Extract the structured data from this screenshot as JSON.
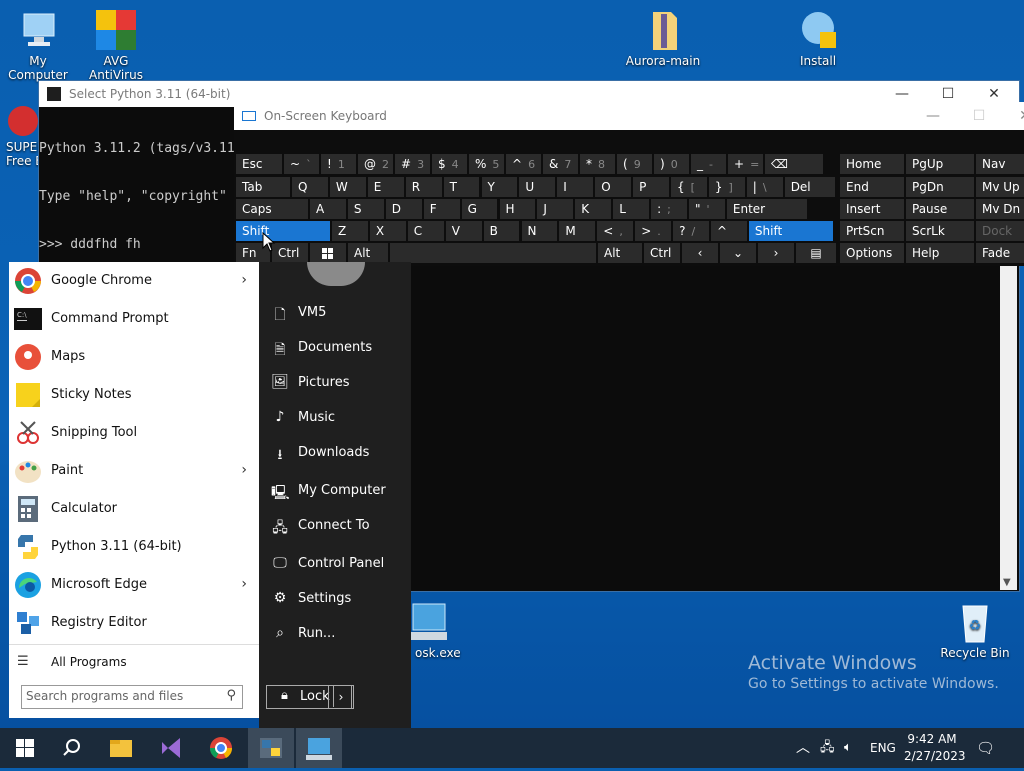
{
  "desktop": {
    "icons": [
      {
        "label": "My Computer"
      },
      {
        "label": "AVG AntiVirus"
      },
      {
        "label": "Aurora-main"
      },
      {
        "label": "Install"
      },
      {
        "label": "SUPER"
      },
      {
        "label": "Free E"
      },
      {
        "label": "osk.exe"
      },
      {
        "label": "Recycle Bin"
      }
    ],
    "watermark": {
      "title": "Activate Windows",
      "subtitle": "Go to Settings to activate Windows."
    }
  },
  "python_window": {
    "title": "Select Python 3.11 (64-bit)",
    "lines": [
      "Python 3.11.2 (tags/v3.11",
      "Type \"help\", \"copyright\"",
      ">>> dddfhd fh"
    ]
  },
  "osk": {
    "title": "On-Screen Keyboard",
    "row1": [
      "Esc",
      "~",
      "!",
      "@",
      "#",
      "$",
      "%",
      "^",
      "&",
      "*",
      "(",
      ")",
      "_",
      "+",
      "⌫"
    ],
    "row1_sub": [
      "",
      "`",
      "1",
      "2",
      "3",
      "4",
      "5",
      "6",
      "7",
      "8",
      "9",
      "0",
      "-",
      "=",
      ""
    ],
    "row2": [
      "Tab",
      "Q",
      "W",
      "E",
      "R",
      "T",
      "Y",
      "U",
      "I",
      "O",
      "P",
      "{",
      "}",
      "|",
      "Del"
    ],
    "row2_sub": [
      "",
      "",
      "",
      "",
      "",
      "",
      "",
      "",
      "",
      "",
      "",
      "[",
      "]",
      "\\",
      ""
    ],
    "row3": [
      "Caps",
      "A",
      "S",
      "D",
      "F",
      "G",
      "H",
      "J",
      "K",
      "L",
      ":",
      "\"",
      "Enter"
    ],
    "row3_sub": [
      "",
      "",
      "",
      "",
      "",
      "",
      "",
      "",
      "",
      "",
      ";",
      "'",
      ""
    ],
    "row4": [
      "Shift",
      "Z",
      "X",
      "C",
      "V",
      "B",
      "N",
      "M",
      "<",
      ">",
      "?",
      "^",
      "Shift"
    ],
    "row4_sub": [
      "",
      "",
      "",
      "",
      "",
      "",
      "",
      "",
      ",",
      ".",
      "/",
      "",
      ""
    ],
    "row5": [
      "Fn",
      "Ctrl",
      "Alt",
      "Alt",
      "Ctrl"
    ],
    "nav": [
      [
        "Home",
        "PgUp",
        "Nav"
      ],
      [
        "End",
        "PgDn",
        "Mv Up"
      ],
      [
        "Insert",
        "Pause",
        "Mv Dn"
      ],
      [
        "PrtScn",
        "ScrLk",
        "Dock"
      ],
      [
        "Options",
        "Help",
        "Fade"
      ]
    ]
  },
  "start_menu": {
    "programs": [
      {
        "label": "Google Chrome",
        "arrow": true
      },
      {
        "label": "Command Prompt",
        "arrow": false
      },
      {
        "label": "Maps",
        "arrow": false
      },
      {
        "label": "Sticky Notes",
        "arrow": false
      },
      {
        "label": "Snipping Tool",
        "arrow": false
      },
      {
        "label": "Paint",
        "arrow": true
      },
      {
        "label": "Calculator",
        "arrow": false
      },
      {
        "label": "Python 3.11 (64-bit)",
        "arrow": false
      },
      {
        "label": "Microsoft Edge",
        "arrow": true
      },
      {
        "label": "Registry Editor",
        "arrow": false
      }
    ],
    "all_programs": "All Programs",
    "search_placeholder": "Search programs and files",
    "places": [
      "VM5",
      "Documents",
      "Pictures",
      "Music",
      "Downloads",
      "My Computer",
      "Connect To",
      "Control Panel",
      "Settings",
      "Run..."
    ],
    "lock": "Lock"
  },
  "taskbar": {
    "lang": "ENG",
    "time": "9:42 AM",
    "date": "2/27/2023"
  }
}
